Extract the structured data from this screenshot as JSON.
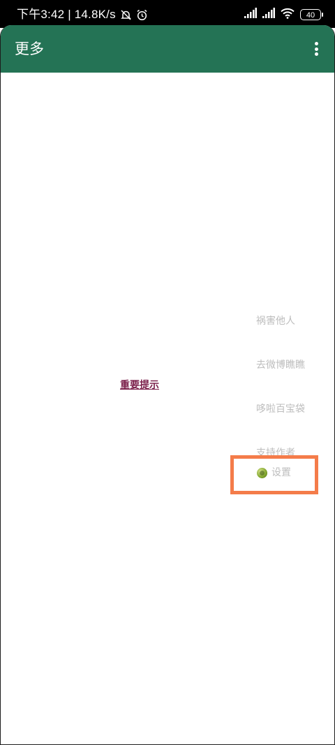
{
  "status_bar": {
    "time_speed": "下午3:42 | 14.8K/s",
    "battery": "40",
    "icons": [
      "mute-icon",
      "alarm-icon",
      "signal-icon",
      "signal-icon",
      "wifi-icon",
      "battery-icon"
    ]
  },
  "app_bar": {
    "title": "更多",
    "overflow_icon": "more-vert-icon"
  },
  "notice_link": "重要提示",
  "menu": {
    "items": [
      {
        "label": "祸害他人"
      },
      {
        "label": "去微博瞧瞧"
      },
      {
        "label": "哆啦百宝袋"
      },
      {
        "label": "支持作者"
      },
      {
        "label": "设置",
        "icon": "settings-icon"
      }
    ]
  },
  "colors": {
    "app_bar": "#247355",
    "highlight": "#f47c4a",
    "link": "#7a1f4a",
    "menu_text": "#bdbdbd"
  }
}
